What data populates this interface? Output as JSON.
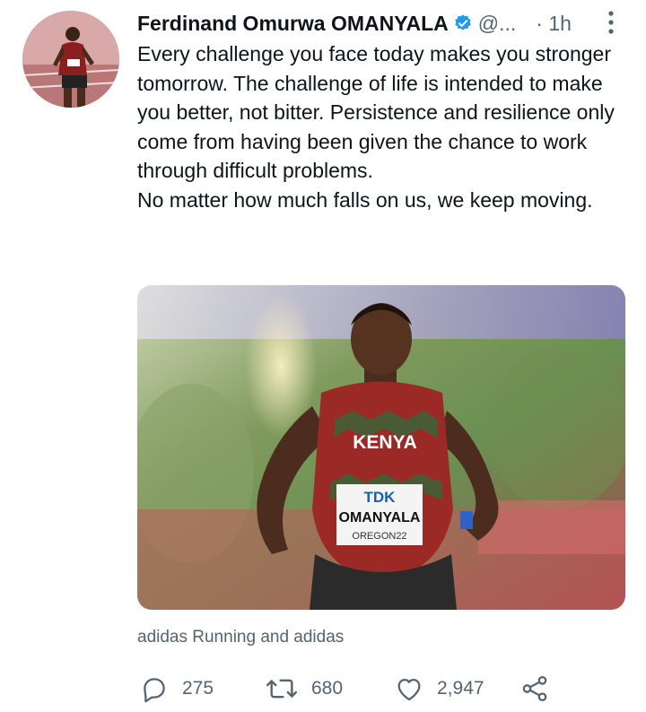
{
  "tweet": {
    "author": {
      "display_name": "Ferdinand Omurwa OMANYALA",
      "handle": "@...",
      "verified": true,
      "time": "· 1h"
    },
    "text": "Every challenge you face today makes you stronger tomorrow. The challenge of life is intended to make you better, not bitter. Persistence and resilience only come from having been given the chance to work through difficult problems.\nNo matter how much falls on us, we keep moving.",
    "media": {
      "jersey_text": "KENYA",
      "bib_brand": "TDK",
      "bib_name": "OMANYALA",
      "bib_event": "OREGON22"
    },
    "media_credit": "adidas Running and adidas",
    "stats": {
      "replies": "275",
      "retweets": "680",
      "likes": "2,947"
    }
  },
  "icons": {
    "verified": "verified-badge-icon",
    "more": "more-vertical-icon",
    "reply": "reply-icon",
    "retweet": "retweet-icon",
    "like": "heart-icon",
    "share": "share-icon"
  },
  "colors": {
    "text": "#0f1419",
    "secondary": "#536471",
    "verified": "#1d9bf0"
  }
}
